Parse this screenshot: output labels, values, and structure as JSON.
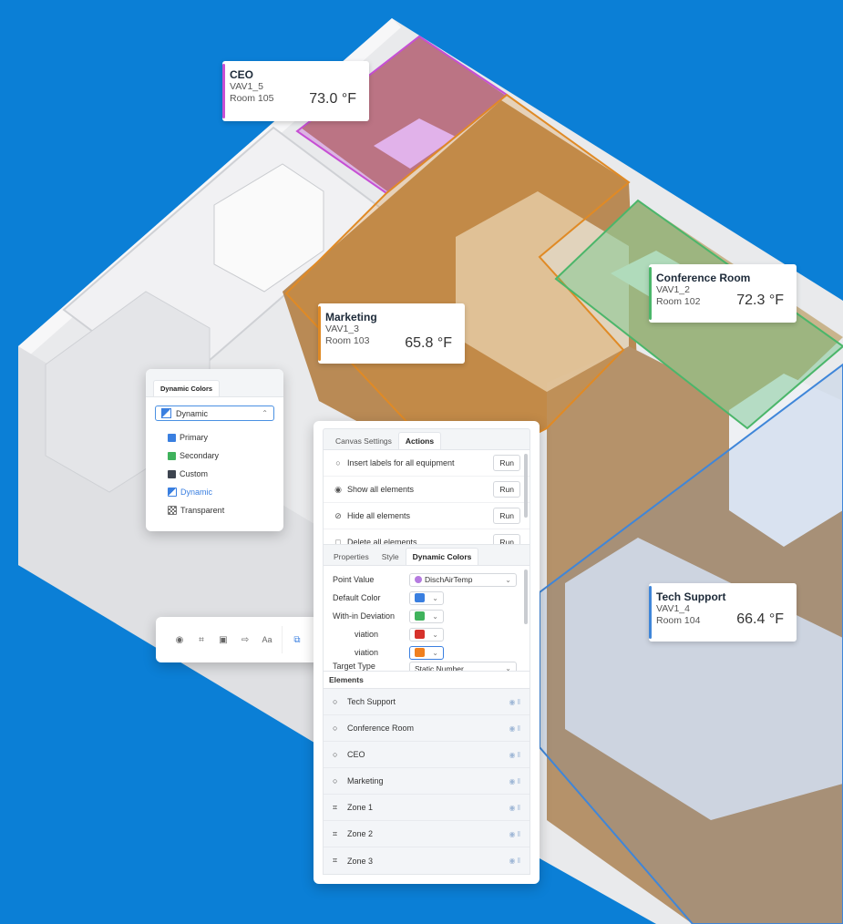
{
  "colors": {
    "background": "#0b7fd6",
    "ceo_zone": "#c64fd4",
    "marketing_zone": "#e08a25",
    "conference_zone": "#4bb66a",
    "techsupport_zone": "#3f86d9",
    "primary": "#3a7fe0",
    "secondary": "#3fb25c",
    "custom": "#3d444f",
    "dynamic": "#3a7fe0",
    "with_in_deviation": "#3fb25c",
    "below_deviation": "#d6322b",
    "above_deviation": "#f0801f"
  },
  "zones": [
    {
      "name": "CEO",
      "equip": "VAV1_5",
      "room": "Room 105",
      "temp": "73.0 °F",
      "accent": "ceo"
    },
    {
      "name": "Marketing",
      "equip": "VAV1_3",
      "room": "Room 103",
      "temp": "65.8 °F",
      "accent": "marketing"
    },
    {
      "name": "Conference Room",
      "equip": "VAV1_2",
      "room": "Room 102",
      "temp": "72.3 °F",
      "accent": "conference"
    },
    {
      "name": "Tech Support",
      "equip": "VAV1_4",
      "room": "Room 104",
      "temp": "66.4 °F",
      "accent": "techsupport"
    }
  ],
  "dynamic_colors_popup": {
    "tab_label": "Dynamic Colors",
    "selected": "Dynamic",
    "options": [
      "Primary",
      "Secondary",
      "Custom",
      "Dynamic",
      "Transparent"
    ]
  },
  "actions_panel": {
    "tabs": [
      "Canvas Settings",
      "Actions"
    ],
    "active_tab": "Actions",
    "rows": [
      {
        "label": "Insert labels for all equipment",
        "button": "Run",
        "icon": "tag-icon"
      },
      {
        "label": "Show all elements",
        "button": "Run",
        "icon": "eye-icon"
      },
      {
        "label": "Hide all elements",
        "button": "Run",
        "icon": "eye-off-icon"
      },
      {
        "label": "Delete all elements",
        "button": "Run",
        "icon": "trash-icon"
      }
    ]
  },
  "properties_panel": {
    "tabs": [
      "Properties",
      "Style",
      "Dynamic Colors"
    ],
    "active_tab": "Dynamic Colors",
    "point_value_label": "Point Value",
    "point_value": "DischAirTemp",
    "default_color_label": "Default Color",
    "within_deviation_label": "With-in Deviation",
    "below_deviation_label": "viation",
    "above_deviation_label": "viation",
    "target_type_label": "Target Type",
    "target_type": "Static Number"
  },
  "elements_panel": {
    "header": "Elements",
    "items": [
      {
        "label": "Tech Support",
        "icon": "tag-icon"
      },
      {
        "label": "Conference Room",
        "icon": "tag-icon"
      },
      {
        "label": "CEO",
        "icon": "tag-icon"
      },
      {
        "label": "Marketing",
        "icon": "tag-icon"
      },
      {
        "label": "Zone 1",
        "icon": "zone-icon"
      },
      {
        "label": "Zone 2",
        "icon": "zone-icon"
      },
      {
        "label": "Zone 3",
        "icon": "zone-icon"
      }
    ]
  },
  "toolbar": {
    "text_tool_label": "Aa"
  }
}
